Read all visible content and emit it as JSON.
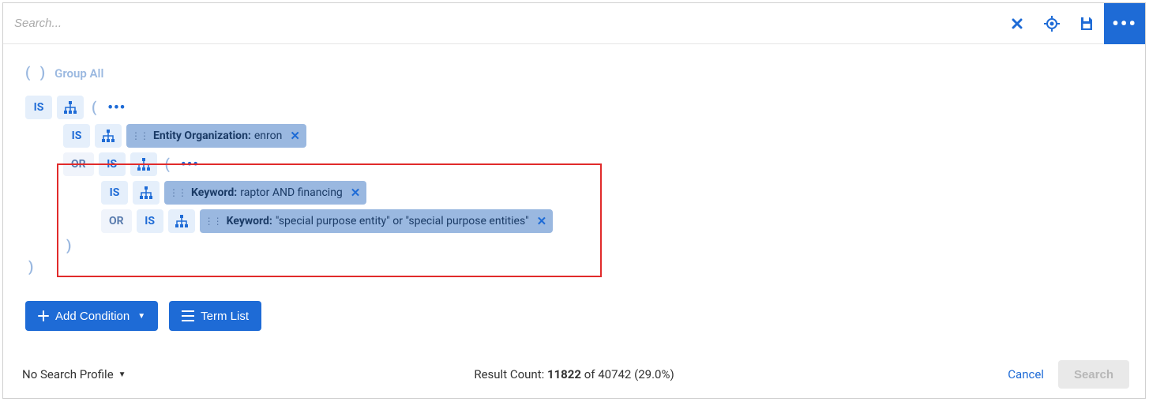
{
  "topbar": {
    "search_placeholder": "Search..."
  },
  "builder": {
    "group_all_label": "Group All",
    "rows": {
      "r0": {
        "is": "IS"
      },
      "r1": {
        "is": "IS",
        "tag_label": "Entity Organization:",
        "tag_value": " enron"
      },
      "r2": {
        "or": "OR",
        "is": "IS"
      },
      "r3": {
        "is": "IS",
        "tag_label": "Keyword:",
        "tag_value": " raptor AND financing"
      },
      "r4": {
        "or": "OR",
        "is": "IS",
        "tag_label": "Keyword:",
        "tag_value": " \"special purpose entity\" or \"special purpose entities\""
      }
    }
  },
  "actions": {
    "add_condition": "Add Condition",
    "term_list": "Term List"
  },
  "footer": {
    "profile": "No Search Profile",
    "result_label": "Result Count: ",
    "result_hits": "11822",
    "result_of": " of 40742 (29.0%)",
    "cancel": "Cancel",
    "search": "Search"
  }
}
